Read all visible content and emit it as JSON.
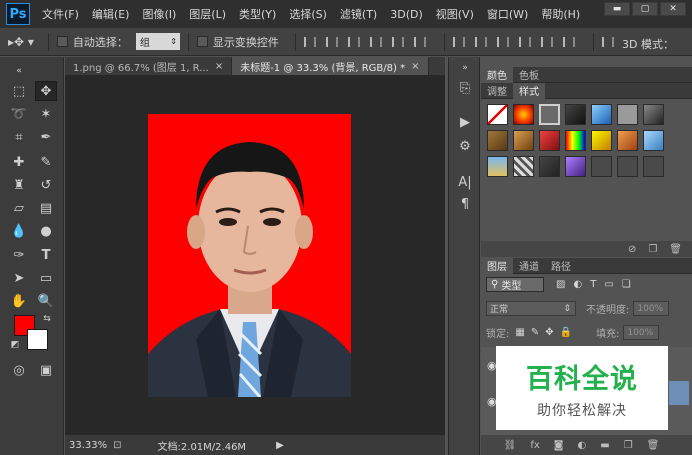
{
  "app": {
    "logo": "Ps"
  },
  "menu": [
    "文件(F)",
    "编辑(E)",
    "图像(I)",
    "图层(L)",
    "类型(Y)",
    "选择(S)",
    "滤镜(T)",
    "3D(D)",
    "视图(V)",
    "窗口(W)",
    "帮助(H)"
  ],
  "window_controls": {
    "minimize": "▬",
    "restore": "▢",
    "close": "✕"
  },
  "options": {
    "auto_select_label": "自动选择：",
    "auto_select_value": "组",
    "show_transform_label": "显示变换控件",
    "mode_3d_label": "3D 模式："
  },
  "tabs": [
    {
      "label": "1.png @ 66.7% (图层 1, R...",
      "close": "×"
    },
    {
      "label": "未标题-1 @ 33.3% (背景, RGB/8) *",
      "close": "×"
    }
  ],
  "status": {
    "zoom": "33.33%",
    "doc_info": "文档:2.01M/2.46M"
  },
  "panels": {
    "top_tabs": [
      "颜色",
      "色板"
    ],
    "mid_tabs": [
      "调整",
      "样式"
    ],
    "layers_tabs": [
      "图层",
      "通道",
      "路径"
    ],
    "kind_filter": "类型",
    "blend_mode": "正常",
    "opacity_label": "不透明度:",
    "opacity_value": "100%",
    "lock_label": "锁定:",
    "fill_label": "填充:",
    "fill_value": "100%"
  },
  "watermark": {
    "title": "百科全说",
    "subtitle": "助你轻松解决"
  },
  "colors": {
    "foreground": "#ff0000",
    "background": "#ffffff",
    "canvas_bg": "#ff0000",
    "brand": "#22b14c"
  }
}
